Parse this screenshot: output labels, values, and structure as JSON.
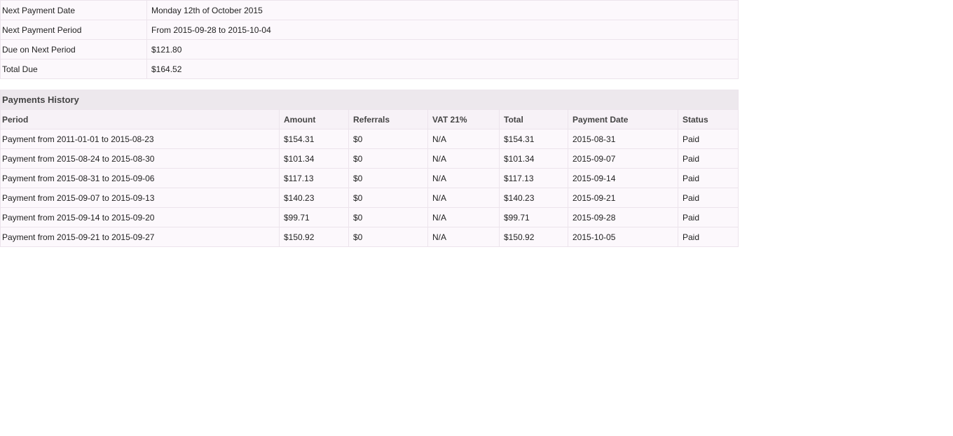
{
  "summary": [
    {
      "label": "Next Payment Date",
      "value": "Monday 12th of October 2015"
    },
    {
      "label": "Next Payment Period",
      "value": "From 2015-09-28 to 2015-10-04"
    },
    {
      "label": "Due on Next Period",
      "value": "$121.80"
    },
    {
      "label": "Total Due",
      "value": "$164.52"
    }
  ],
  "history": {
    "title": "Payments History",
    "columns": [
      "Period",
      "Amount",
      "Referrals",
      "VAT 21%",
      "Total",
      "Payment Date",
      "Status"
    ],
    "rows": [
      [
        "Payment from 2011-01-01 to 2015-08-23",
        "$154.31",
        "$0",
        "N/A",
        "$154.31",
        "2015-08-31",
        "Paid"
      ],
      [
        "Payment from 2015-08-24 to 2015-08-30",
        "$101.34",
        "$0",
        "N/A",
        "$101.34",
        "2015-09-07",
        "Paid"
      ],
      [
        "Payment from 2015-08-31 to 2015-09-06",
        "$117.13",
        "$0",
        "N/A",
        "$117.13",
        "2015-09-14",
        "Paid"
      ],
      [
        "Payment from 2015-09-07 to 2015-09-13",
        "$140.23",
        "$0",
        "N/A",
        "$140.23",
        "2015-09-21",
        "Paid"
      ],
      [
        "Payment from 2015-09-14 to 2015-09-20",
        "$99.71",
        "$0",
        "N/A",
        "$99.71",
        "2015-09-28",
        "Paid"
      ],
      [
        "Payment from 2015-09-21 to 2015-09-27",
        "$150.92",
        "$0",
        "N/A",
        "$150.92",
        "2015-10-05",
        "Paid"
      ]
    ]
  }
}
